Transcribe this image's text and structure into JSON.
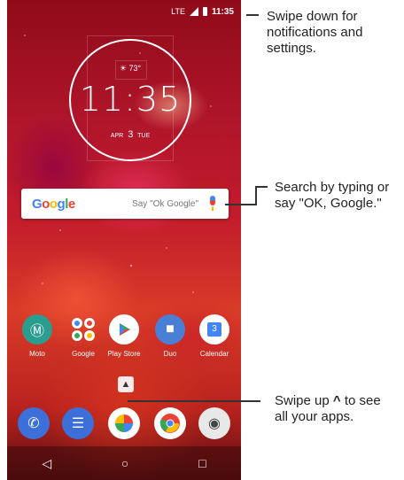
{
  "status_bar": {
    "network": "LTE",
    "time": "11:35"
  },
  "clock_widget": {
    "weather": "73°",
    "weather_icon": "sun-icon",
    "time": "11:35",
    "month": "APR",
    "day": "3",
    "weekday": "TUE"
  },
  "search": {
    "logo": "Google",
    "hint": "Say \"Ok Google\""
  },
  "apps": [
    {
      "label": "Moto",
      "icon": "moto-icon",
      "color": "#2a9d8f"
    },
    {
      "label": "Google",
      "icon": "google-folder-icon",
      "color": "#ffffff"
    },
    {
      "label": "Play Store",
      "icon": "play-store-icon",
      "color": "#ffffff"
    },
    {
      "label": "Duo",
      "icon": "duo-icon",
      "color": "#4a7fd6"
    },
    {
      "label": "Calendar",
      "icon": "calendar-icon",
      "color": "#ffffff",
      "badge": "3"
    }
  ],
  "dock": [
    {
      "icon": "phone-icon",
      "color": "#3d6fd8"
    },
    {
      "icon": "messages-icon",
      "color": "#3d6fd8"
    },
    {
      "icon": "photos-icon",
      "color": "#ffffff"
    },
    {
      "icon": "chrome-icon",
      "color": "#ffffff"
    },
    {
      "icon": "camera-icon",
      "color": "#e8e8e8"
    }
  ],
  "nav": {
    "back": "◁",
    "home": "○",
    "recents": "□"
  },
  "callouts": {
    "notifications": "Swipe down for notifications and settings.",
    "search_line1": "Search by typing or",
    "search_line2": "say \"OK, Google.\"",
    "apps_line1": "Swipe up",
    "apps_line1b": "to see",
    "apps_line2": "all your apps.",
    "chevron": "^"
  }
}
